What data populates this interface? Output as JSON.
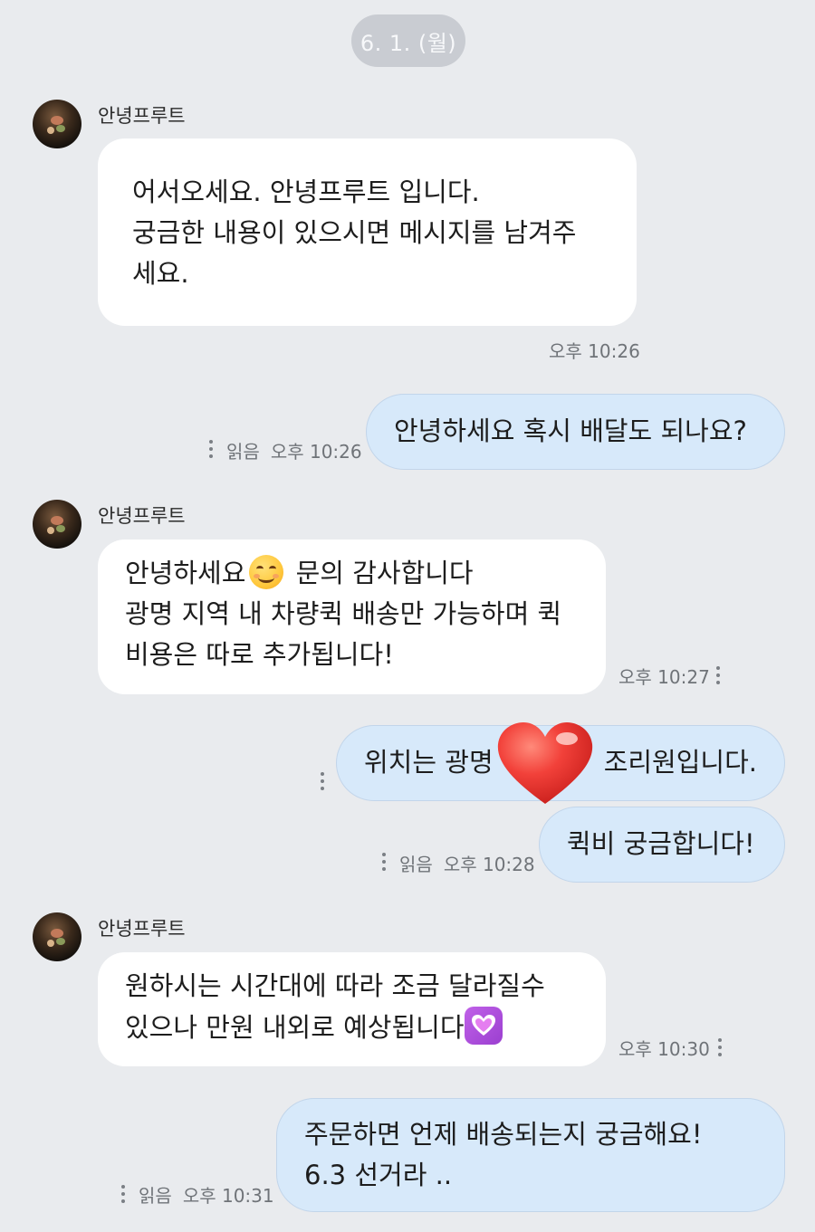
{
  "date_divider": "6. 1. (월)",
  "colors": {
    "background": "#e9ebee",
    "incoming_bubble": "#ffffff",
    "outgoing_bubble": "#d7e9fa",
    "date_pill": "#c9ccd2",
    "heart_reaction": "#ef3b36"
  },
  "icons": {
    "menu": "vertical-dots-icon",
    "reaction": "heart-reaction-icon",
    "emoji_smile": "smiling-face-emoji",
    "emoji_heart": "purple-heart-emoji"
  },
  "messages": {
    "m1": {
      "sender": "안녕프루트",
      "line1": "어서오세요. 안녕프루트 입니다.",
      "line2": "궁금한 내용이 있으시면 메시지를 남겨주",
      "line3": "세요.",
      "time": "오후 10:26"
    },
    "m2": {
      "text": "안녕하세요 혹시 배달도 되나요?",
      "read": "읽음",
      "time": "오후 10:26"
    },
    "m3": {
      "sender": "안녕프루트",
      "line1a": "안녕하세요",
      "line1b": "문의 감사합니다",
      "line2": "광명 지역 내 차량퀵 배송만 가능하며 퀵",
      "line3": "비용은 따로 추가됩니다!",
      "time": "오후 10:27"
    },
    "m4": {
      "text_left": "위치는 광명",
      "text_right": "조리원입니다."
    },
    "m5": {
      "text": "퀵비 궁금합니다!",
      "read": "읽음",
      "time": "오후 10:28"
    },
    "m6": {
      "sender": "안녕프루트",
      "line1": "원하시는 시간대에 따라 조금 달라질수",
      "line2": "있으나 만원 내외로 예상됩니다",
      "time": "오후 10:30"
    },
    "m7": {
      "line1": "주문하면 언제 배송되는지 궁금해요!",
      "line2": "6.3 선거라 ..",
      "read": "읽음",
      "time": "오후 10:31"
    }
  }
}
